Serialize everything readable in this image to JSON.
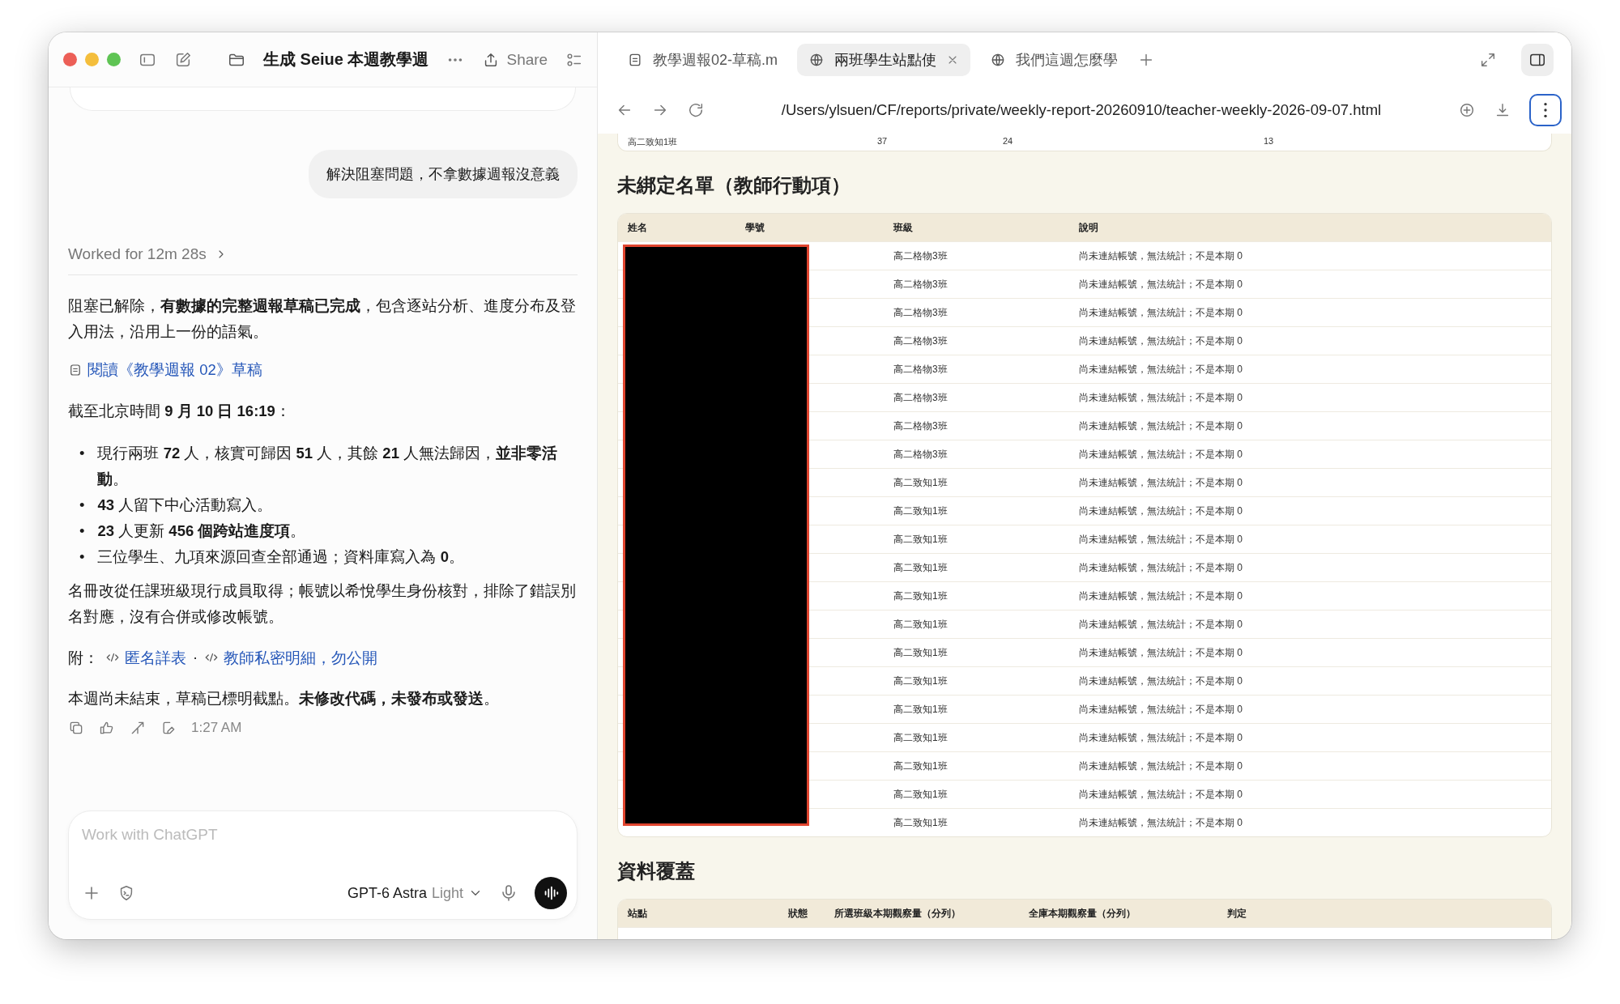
{
  "window": {
    "title": "生成 Seiue 本週教學週",
    "share": "Share"
  },
  "chat": {
    "user_message": "解決阻塞問題，不拿數據週報沒意義",
    "worked": "Worked for 12m 28s",
    "intro": "阻塞已解除，**有數據的完整週報草稿已完成**，包含逐站分析、進度分布及登入用法，沿用上一份的語氣。",
    "doc_link": "閱讀《教學週報 02》草稿",
    "as_of": "截至北京時間 **9 月 10 日 16:19**：",
    "bullet_marker": "•",
    "bullets": [
      "現行兩班 **72** 人，核實可歸因 **51** 人，其餘 **21** 人無法歸因，**並非零活動**。",
      "**43** 人留下中心活動寫入。",
      "**23** 人更新 **456 個跨站進度項**。",
      "三位學生、九項來源回查全部通過；資料庫寫入為 **0**。"
    ],
    "roster_note": "名冊改從任課班級現行成員取得；帳號以希悅學生身份核對，排除了錯誤別名對應，沒有合併或修改帳號。",
    "attachments_label": "附：",
    "attachments": [
      "匿名詳表",
      "教師私密明細，勿公開"
    ],
    "attachment_separator": "·",
    "closing": "本週尚未結束，草稿已標明截點。**未修改代碼，未發布或發送**。",
    "time": "1:27 AM"
  },
  "composer": {
    "placeholder": "Work with ChatGPT",
    "model": "GPT-6 Astra",
    "effort": "Light"
  },
  "browser": {
    "tabs": [
      {
        "label": "教學週報02-草稿.m",
        "kind": "file",
        "selected": false
      },
      {
        "label": "兩班學生站點使",
        "kind": "web",
        "selected": true
      },
      {
        "label": "我們這週怎麼學",
        "kind": "web",
        "selected": false
      }
    ],
    "url": "/Users/ylsuen/CF/reports/private/weekly-report-20260910/teacher-weekly-2026-09-07.html"
  },
  "report": {
    "previous_row": [
      "高二致知1班",
      "37",
      "24",
      "13"
    ],
    "unbound": {
      "heading": "未綁定名單（教師行動項）",
      "columns": [
        "姓名",
        "學號",
        "班級",
        "說明"
      ],
      "rows": [
        {
          "class": "高二格物3班",
          "note": "尚未連結帳號，無法統計；不是本期 0"
        },
        {
          "class": "高二格物3班",
          "note": "尚未連結帳號，無法統計；不是本期 0"
        },
        {
          "class": "高二格物3班",
          "note": "尚未連結帳號，無法統計；不是本期 0"
        },
        {
          "class": "高二格物3班",
          "note": "尚未連結帳號，無法統計；不是本期 0"
        },
        {
          "class": "高二格物3班",
          "note": "尚未連結帳號，無法統計；不是本期 0"
        },
        {
          "class": "高二格物3班",
          "note": "尚未連結帳號，無法統計；不是本期 0"
        },
        {
          "class": "高二格物3班",
          "note": "尚未連結帳號，無法統計；不是本期 0"
        },
        {
          "class": "高二格物3班",
          "note": "尚未連結帳號，無法統計；不是本期 0"
        },
        {
          "class": "高二致知1班",
          "note": "尚未連結帳號，無法統計；不是本期 0"
        },
        {
          "class": "高二致知1班",
          "note": "尚未連結帳號，無法統計；不是本期 0"
        },
        {
          "class": "高二致知1班",
          "note": "尚未連結帳號，無法統計；不是本期 0"
        },
        {
          "class": "高二致知1班",
          "note": "尚未連結帳號，無法統計；不是本期 0"
        },
        {
          "class": "高二致知1班",
          "note": "尚未連結帳號，無法統計；不是本期 0"
        },
        {
          "class": "高二致知1班",
          "note": "尚未連結帳號，無法統計；不是本期 0"
        },
        {
          "class": "高二致知1班",
          "note": "尚未連結帳號，無法統計；不是本期 0"
        },
        {
          "class": "高二致知1班",
          "note": "尚未連結帳號，無法統計；不是本期 0"
        },
        {
          "class": "高二致知1班",
          "note": "尚未連結帳號，無法統計；不是本期 0"
        },
        {
          "class": "高二致知1班",
          "note": "尚未連結帳號，無法統計；不是本期 0"
        },
        {
          "class": "高二致知1班",
          "note": "尚未連結帳號，無法統計；不是本期 0"
        },
        {
          "class": "高二致知1班",
          "note": "尚未連結帳號，無法統計；不是本期 0"
        },
        {
          "class": "高二致知1班",
          "note": "尚未連結帳號，無法統計；不是本期 0"
        }
      ]
    },
    "coverage": {
      "heading": "資料覆蓋",
      "columns": [
        "站點",
        "狀態",
        "所選班級本期觀察量（分列）",
        "全庫本期觀察量（分列）",
        "判定"
      ]
    }
  }
}
